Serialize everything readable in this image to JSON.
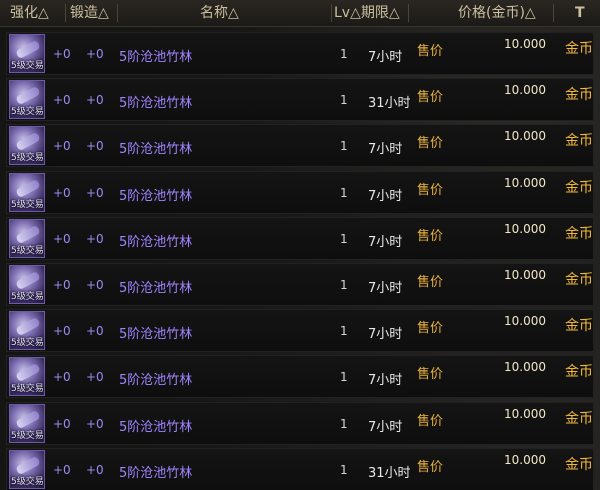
{
  "header": {
    "col_qianghua": "强化△",
    "col_duanzao": "锻造△",
    "col_name": "名称△",
    "col_lv_period": "Lv△期限△",
    "col_price": "价格(金币)△",
    "col_extra": "T"
  },
  "item_icon_tag": "5级交易",
  "rows": [
    {
      "qianghua": "+0",
      "duanzao": "+0",
      "name": "5阶沧池竹林",
      "lv": "1",
      "period": "7小时",
      "sale": "售价",
      "price": "10.000",
      "currency": "金币"
    },
    {
      "qianghua": "+0",
      "duanzao": "+0",
      "name": "5阶沧池竹林",
      "lv": "1",
      "period": "31小时",
      "sale": "售价",
      "price": "10.000",
      "currency": "金币"
    },
    {
      "qianghua": "+0",
      "duanzao": "+0",
      "name": "5阶沧池竹林",
      "lv": "1",
      "period": "7小时",
      "sale": "售价",
      "price": "10.000",
      "currency": "金币"
    },
    {
      "qianghua": "+0",
      "duanzao": "+0",
      "name": "5阶沧池竹林",
      "lv": "1",
      "period": "7小时",
      "sale": "售价",
      "price": "10.000",
      "currency": "金币"
    },
    {
      "qianghua": "+0",
      "duanzao": "+0",
      "name": "5阶沧池竹林",
      "lv": "1",
      "period": "7小时",
      "sale": "售价",
      "price": "10.000",
      "currency": "金币"
    },
    {
      "qianghua": "+0",
      "duanzao": "+0",
      "name": "5阶沧池竹林",
      "lv": "1",
      "period": "7小时",
      "sale": "售价",
      "price": "10.000",
      "currency": "金币"
    },
    {
      "qianghua": "+0",
      "duanzao": "+0",
      "name": "5阶沧池竹林",
      "lv": "1",
      "period": "7小时",
      "sale": "售价",
      "price": "10.000",
      "currency": "金币"
    },
    {
      "qianghua": "+0",
      "duanzao": "+0",
      "name": "5阶沧池竹林",
      "lv": "1",
      "period": "7小时",
      "sale": "售价",
      "price": "10.000",
      "currency": "金币"
    },
    {
      "qianghua": "+0",
      "duanzao": "+0",
      "name": "5阶沧池竹林",
      "lv": "1",
      "period": "7小时",
      "sale": "售价",
      "price": "10.000",
      "currency": "金币"
    },
    {
      "qianghua": "+0",
      "duanzao": "+0",
      "name": "5阶沧池竹林",
      "lv": "1",
      "period": "31小时",
      "sale": "售价",
      "price": "10.000",
      "currency": "金币"
    }
  ]
}
